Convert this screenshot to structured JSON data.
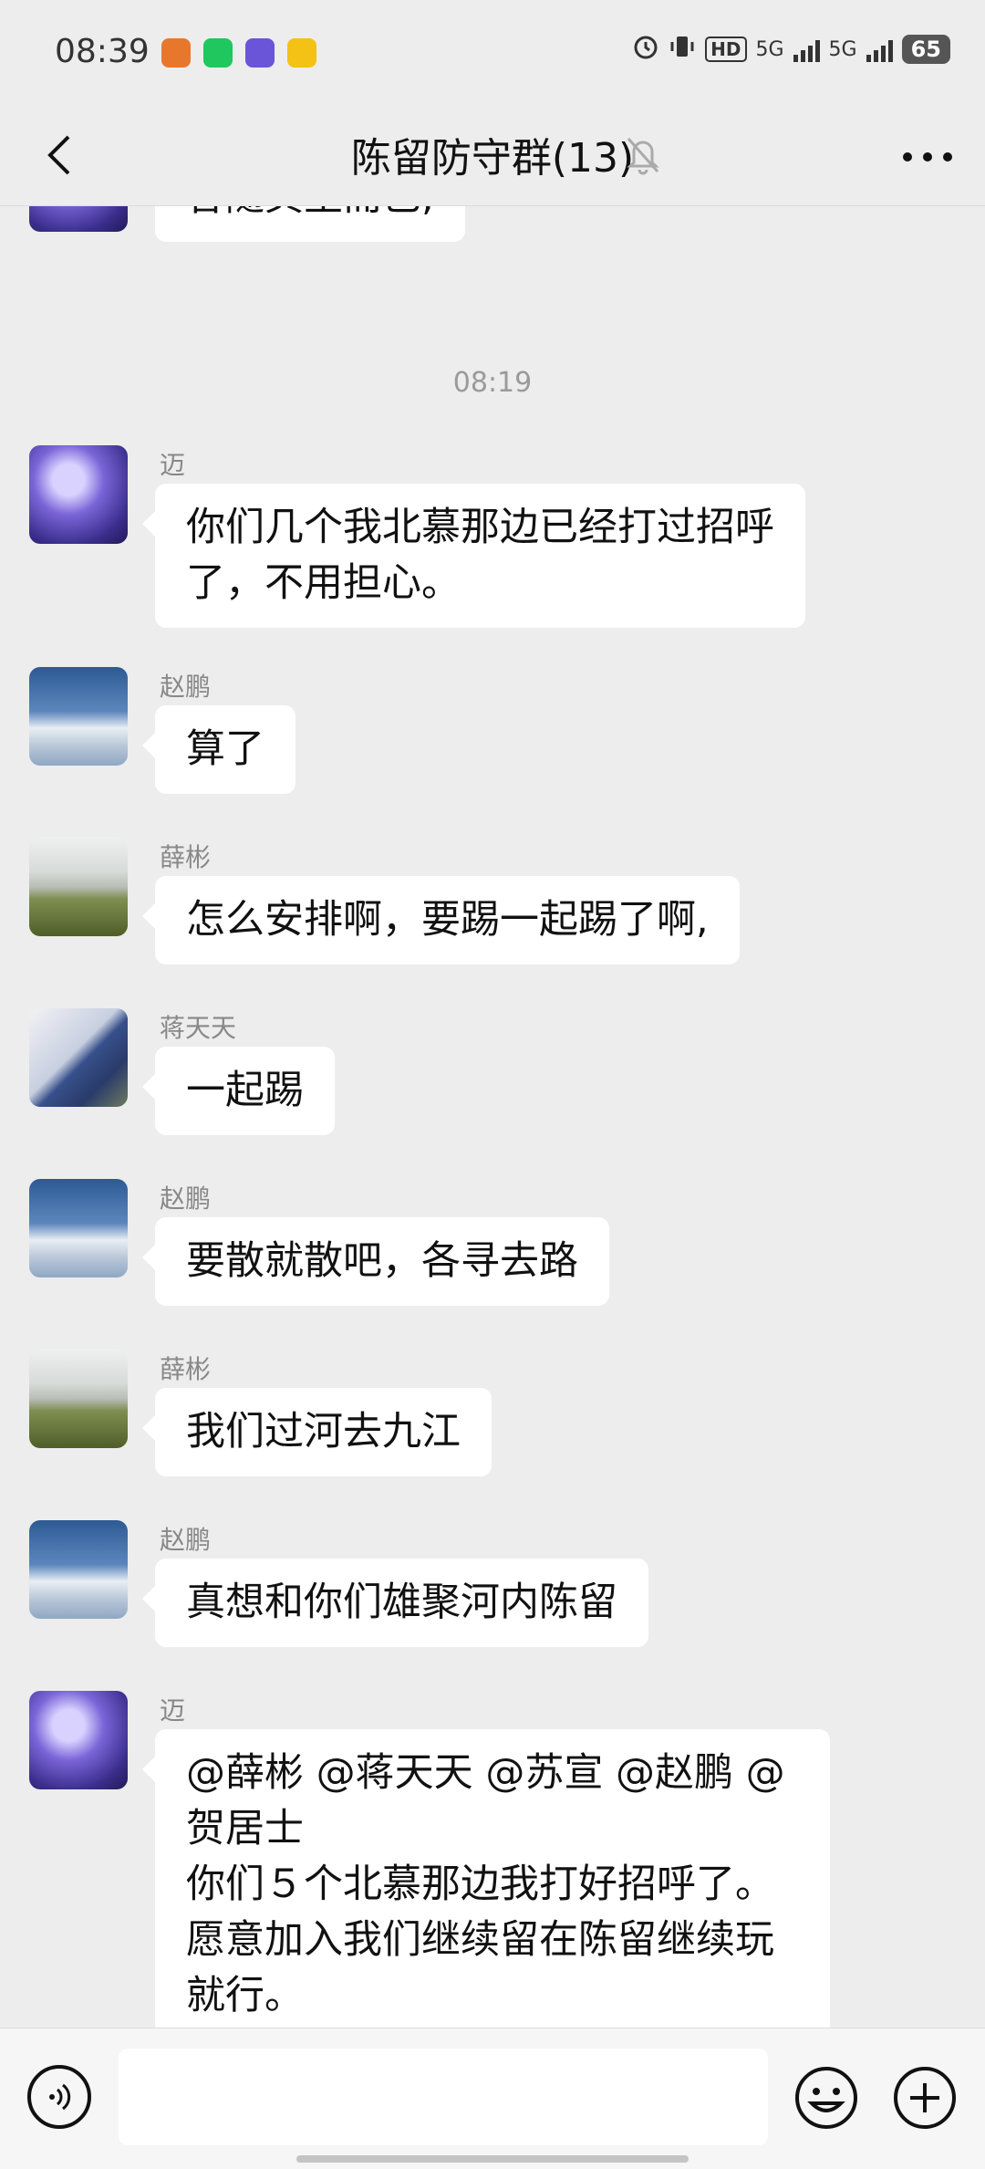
{
  "status_bar": {
    "time": "08:39",
    "app_icons": [
      {
        "name": "app-icon-1",
        "color": "#e8772e"
      },
      {
        "name": "iqiyi-icon",
        "color": "#1fc75e"
      },
      {
        "name": "app-icon-3",
        "color": "#6a55d9"
      },
      {
        "name": "app-icon-4",
        "color": "#f3c214"
      }
    ],
    "network_1": "5G",
    "network_2": "5G",
    "hd_label": "HD",
    "battery": "65"
  },
  "header": {
    "title": "陈留防守群(13)"
  },
  "chat": {
    "messages": [
      {
        "sender": "",
        "text": "各随其主而已,",
        "avatar": "unicorn"
      },
      {
        "sender": "迈",
        "text": "你们几个我北慕那边已经打过招呼\n了，不用担心。",
        "avatar": "unicorn"
      },
      {
        "sender": "赵鹏",
        "text": "算了",
        "avatar": "sky"
      },
      {
        "sender": "薛彬",
        "text": "怎么安排啊，要踢一起踢了啊,",
        "avatar": "field"
      },
      {
        "sender": "蒋天天",
        "text": "一起踢",
        "avatar": "figure"
      },
      {
        "sender": "赵鹏",
        "text": "要散就散吧，各寻去路",
        "avatar": "sky"
      },
      {
        "sender": "薛彬",
        "text": "我们过河去九江",
        "avatar": "field"
      },
      {
        "sender": "赵鹏",
        "text": "真想和你们雄聚河内陈留",
        "avatar": "sky"
      },
      {
        "sender": "迈",
        "text": "@薛彬 @蒋天天 @苏宣 @赵鹏 @\n贺居士\n你们５个北慕那边我打好招呼了。\n愿意加入我们继续留在陈留继续玩\n就行。",
        "avatar": "unicorn"
      }
    ],
    "timestamp": "08:19"
  },
  "input": {
    "placeholder": ""
  }
}
